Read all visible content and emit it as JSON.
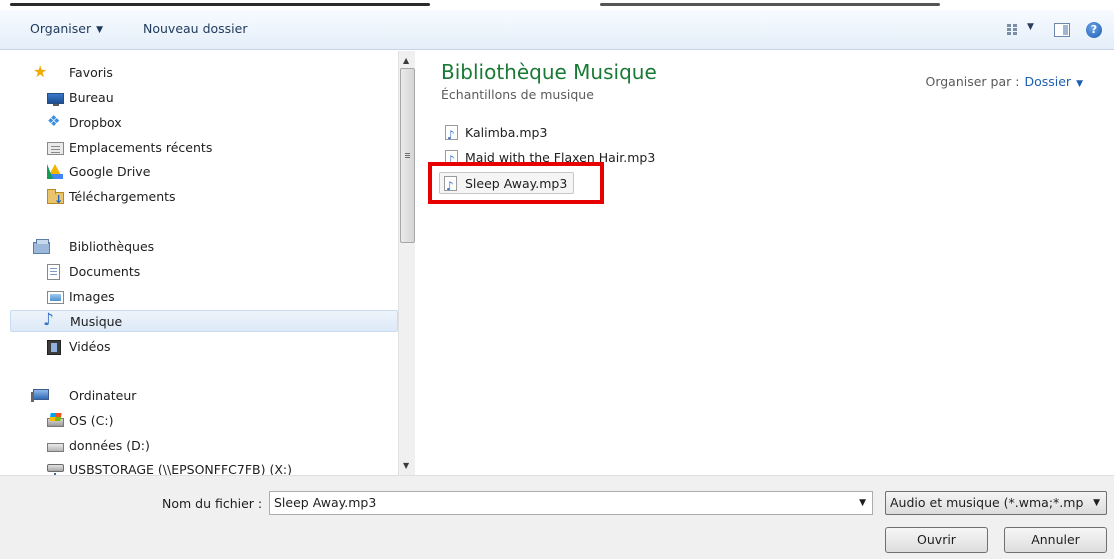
{
  "toolbar": {
    "organise_label": "Organiser",
    "new_folder_label": "Nouveau dossier",
    "help_symbol": "?"
  },
  "nav": {
    "favorites": {
      "label": "Favoris",
      "items": [
        {
          "label": "Bureau",
          "icon": "desktop-icon"
        },
        {
          "label": "Dropbox",
          "icon": "dropbox-icon"
        },
        {
          "label": "Emplacements récents",
          "icon": "recent-places-icon"
        },
        {
          "label": "Google Drive",
          "icon": "google-drive-icon"
        },
        {
          "label": "Téléchargements",
          "icon": "downloads-icon"
        }
      ]
    },
    "libraries": {
      "label": "Bibliothèques",
      "items": [
        {
          "label": "Documents",
          "icon": "documents-icon"
        },
        {
          "label": "Images",
          "icon": "images-icon"
        },
        {
          "label": "Musique",
          "icon": "music-icon",
          "selected": true
        },
        {
          "label": "Vidéos",
          "icon": "videos-icon"
        }
      ]
    },
    "computer": {
      "label": "Ordinateur",
      "items": [
        {
          "label": "OS (C:)",
          "icon": "windows-drive-icon"
        },
        {
          "label": "données (D:)",
          "icon": "drive-icon"
        },
        {
          "label": "USBSTORAGE (\\\\EPSONFFC7FB) (X:)",
          "icon": "network-drive-icon"
        }
      ]
    }
  },
  "content": {
    "library_title": "Bibliothèque Musique",
    "library_subtitle": "Échantillons de musique",
    "arrange_label": "Organiser par :",
    "arrange_value": "Dossier",
    "files": [
      {
        "name": "Kalimba.mp3",
        "selected": false
      },
      {
        "name": "Maid with the Flaxen Hair.mp3",
        "selected": false
      },
      {
        "name": "Sleep Away.mp3",
        "selected": true
      }
    ],
    "highlight_color": "#e60000"
  },
  "bottom": {
    "filename_label": "Nom du fichier :",
    "filename_value": "Sleep Away.mp3",
    "filter_value": "Audio et musique (*.wma;*.mp",
    "open_label": "Ouvrir",
    "cancel_label": "Annuler"
  }
}
